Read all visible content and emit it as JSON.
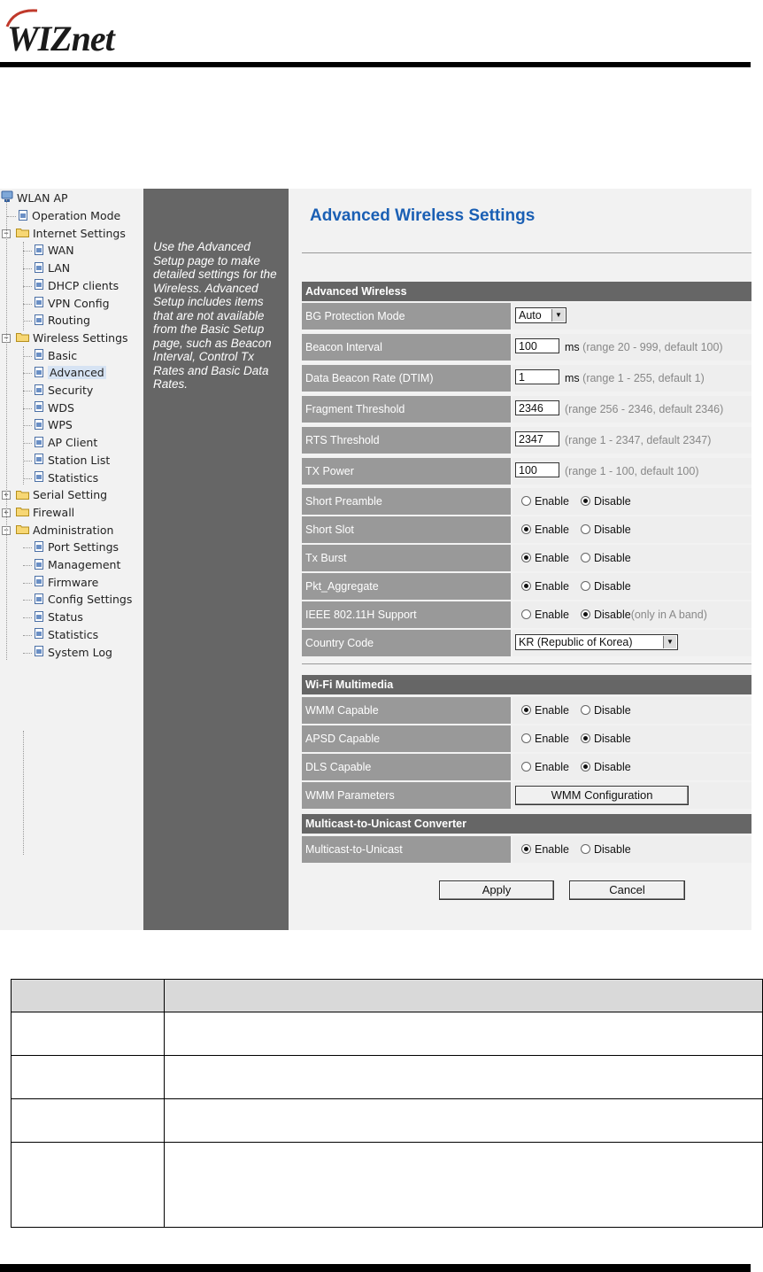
{
  "logo": {
    "text": "WIZnet"
  },
  "tree": {
    "root": "WLAN AP",
    "items": [
      {
        "label": "Operation Mode",
        "depth": 1,
        "type": "page"
      },
      {
        "label": "Internet Settings",
        "depth": 0,
        "type": "folder",
        "expanded": true
      },
      {
        "label": "WAN",
        "depth": 2,
        "type": "page"
      },
      {
        "label": "LAN",
        "depth": 2,
        "type": "page"
      },
      {
        "label": "DHCP clients",
        "depth": 2,
        "type": "page"
      },
      {
        "label": "VPN Config",
        "depth": 2,
        "type": "page"
      },
      {
        "label": "Routing",
        "depth": 2,
        "type": "page"
      },
      {
        "label": "Wireless Settings",
        "depth": 0,
        "type": "folder",
        "expanded": true
      },
      {
        "label": "Basic",
        "depth": 2,
        "type": "page"
      },
      {
        "label": "Advanced",
        "depth": 2,
        "type": "page",
        "selected": true
      },
      {
        "label": "Security",
        "depth": 2,
        "type": "page"
      },
      {
        "label": "WDS",
        "depth": 2,
        "type": "page"
      },
      {
        "label": "WPS",
        "depth": 2,
        "type": "page"
      },
      {
        "label": "AP Client",
        "depth": 2,
        "type": "page"
      },
      {
        "label": "Station List",
        "depth": 2,
        "type": "page"
      },
      {
        "label": "Statistics",
        "depth": 2,
        "type": "page"
      },
      {
        "label": "Serial Setting",
        "depth": 0,
        "type": "folder",
        "expanded": false
      },
      {
        "label": "Firewall",
        "depth": 0,
        "type": "folder",
        "expanded": false
      },
      {
        "label": "Administration",
        "depth": 0,
        "type": "folder",
        "expanded": true
      },
      {
        "label": "Port Settings",
        "depth": 2,
        "type": "page"
      },
      {
        "label": "Management",
        "depth": 2,
        "type": "page"
      },
      {
        "label": "Firmware",
        "depth": 2,
        "type": "page"
      },
      {
        "label": "Config Settings",
        "depth": 2,
        "type": "page"
      },
      {
        "label": "Status",
        "depth": 2,
        "type": "page"
      },
      {
        "label": "Statistics",
        "depth": 2,
        "type": "page"
      },
      {
        "label": "System Log",
        "depth": 2,
        "type": "page"
      }
    ]
  },
  "help": {
    "text": "Use the Advanced Setup page to make detailed settings for the Wireless. Advanced Setup includes items that are not available from the Basic Setup page, such as Beacon Interval, Control Tx Rates and Basic Data Rates."
  },
  "page": {
    "title": "Advanced Wireless Settings",
    "advanced_wireless": {
      "header": "Advanced Wireless",
      "bg_protection": {
        "label": "BG Protection Mode",
        "value": "Auto"
      },
      "beacon_interval": {
        "label": "Beacon Interval",
        "value": "100",
        "unit": "ms",
        "hint": "(range 20 - 999, default 100)"
      },
      "dtim": {
        "label": "Data Beacon Rate (DTIM)",
        "value": "1",
        "unit": "ms",
        "hint": "(range 1 - 255, default 1)"
      },
      "fragment": {
        "label": "Fragment Threshold",
        "value": "2346",
        "hint": "(range 256 - 2346, default 2346)"
      },
      "rts": {
        "label": "RTS Threshold",
        "value": "2347",
        "hint": "(range 1 - 2347, default 2347)"
      },
      "tx_power": {
        "label": "TX Power",
        "value": "100",
        "hint": "(range 1 - 100, default 100)"
      },
      "short_preamble": {
        "label": "Short Preamble",
        "enabled": false
      },
      "short_slot": {
        "label": "Short Slot",
        "enabled": true
      },
      "tx_burst": {
        "label": "Tx Burst",
        "enabled": true
      },
      "pkt_aggregate": {
        "label": "Pkt_Aggregate",
        "enabled": true
      },
      "ieee80211h": {
        "label": "IEEE 802.11H Support",
        "enabled": false,
        "note": "(only in A band)"
      },
      "country_code": {
        "label": "Country Code",
        "value": "KR (Republic of Korea)"
      }
    },
    "wifi_multimedia": {
      "header": "Wi-Fi Multimedia",
      "wmm_capable": {
        "label": "WMM Capable",
        "enabled": true
      },
      "apsd_capable": {
        "label": "APSD Capable",
        "enabled": false
      },
      "dls_capable": {
        "label": "DLS Capable",
        "enabled": false
      },
      "wmm_parameters": {
        "label": "WMM Parameters",
        "button": "WMM Configuration"
      }
    },
    "multicast": {
      "header": "Multicast-to-Unicast Converter",
      "m2u": {
        "label": "Multicast-to-Unicast",
        "enabled": true
      }
    },
    "radio": {
      "enable": "Enable",
      "disable": "Disable"
    },
    "apply": "Apply",
    "cancel": "Cancel"
  },
  "colors": {
    "title_blue": "#1a5fb4",
    "section_header": "#666666",
    "label_cell": "#999999",
    "help_panel": "#666666"
  }
}
